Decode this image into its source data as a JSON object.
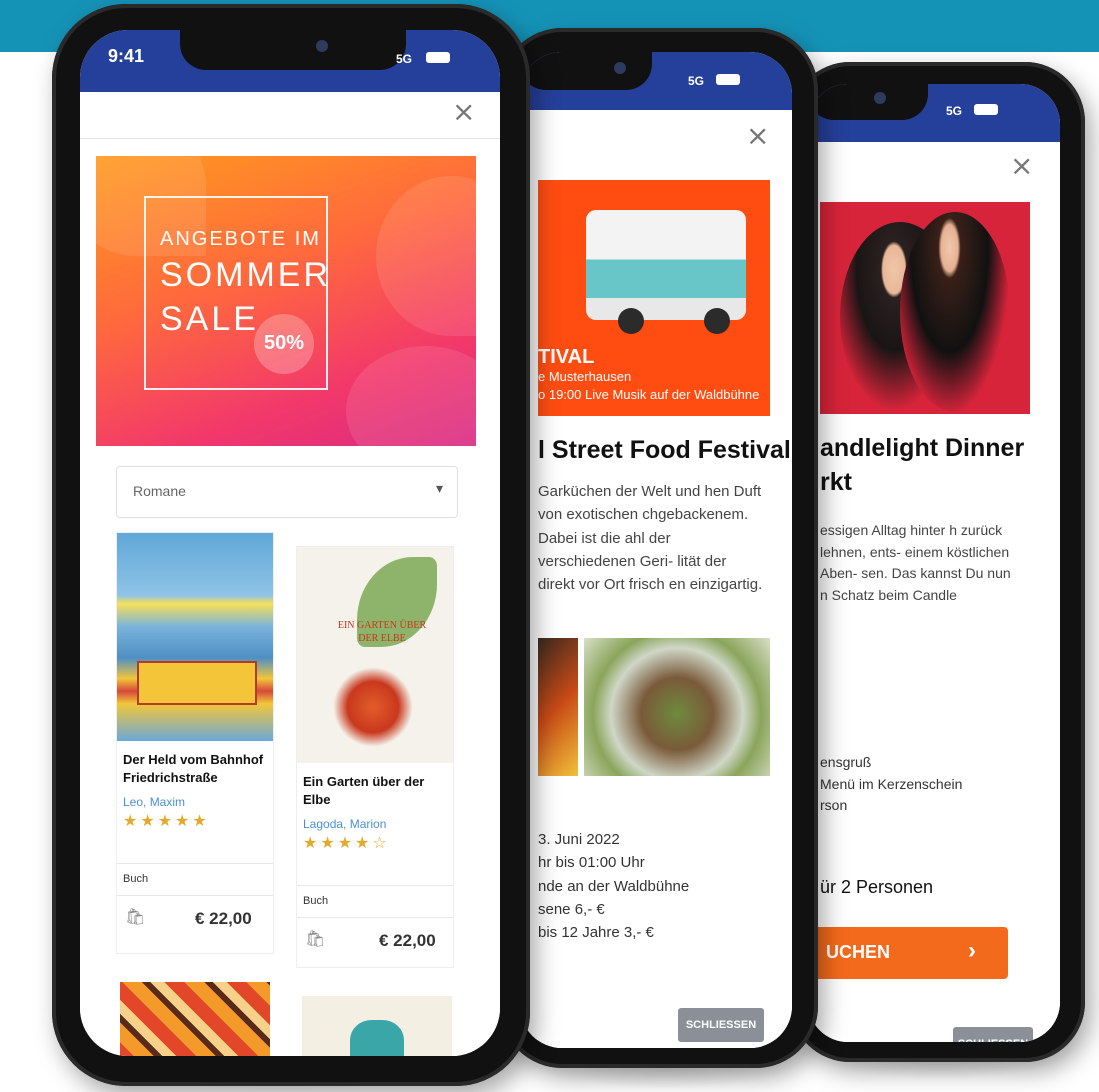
{
  "phone1": {
    "status": {
      "time": "9:41",
      "network": "5G"
    },
    "close": "×",
    "banner": {
      "line1": "ANGEBOTE IM",
      "line2": "SOMMER",
      "line3": "SALE",
      "badge_pct": "50%"
    },
    "filter": {
      "selected": "Romane",
      "arrow": "▾"
    },
    "books": [
      {
        "title": "Der Held vom Bahnhof Friedrichstraße",
        "author": "Leo, Maxim",
        "stars": "★★★★★",
        "rating": 5,
        "type": "Buch",
        "price": "€ 22,00"
      },
      {
        "title": "Ein Garten über der Elbe",
        "author": "Lagoda, Marion",
        "stars": "★★★★☆",
        "rating": 4,
        "type": "Buch",
        "price": "€ 22,00"
      }
    ],
    "cover_texts": {
      "garten": "EIN GARTEN ÜBER DER ELBE"
    }
  },
  "phone2": {
    "status": {
      "network": "5G"
    },
    "close": "×",
    "banner": {
      "line1": "TIVAL",
      "line2": "e Musterhausen",
      "line3": "o 19:00 Live Musik auf der Waldbühne"
    },
    "heading": "l Street Food Festival",
    "paragraph": "Garküchen der Welt und hen Duft von exotischen chgebackenem. Dabei ist die ahl der verschiedenen Geri- lität der direkt vor Ort frisch en einzigartig.",
    "info": [
      "3. Juni 2022",
      "hr bis 01:00 Uhr",
      "nde an der Waldbühne",
      "sene 6,- €",
      "bis 12 Jahre 3,- €"
    ],
    "close_button": "SCHLIESSEN"
  },
  "phone3": {
    "status": {
      "network": "5G"
    },
    "close": "×",
    "heading_line1": "andlelight Dinner",
    "heading_line2": "rkt",
    "paragraph": "essigen Alltag hinter h zurück lehnen, ents- einem köstlichen Aben- sen. Das kannst Du nun n Schatz beim Candle",
    "info": [
      "ensgruß",
      "Menü im Kerzenschein",
      "rson"
    ],
    "price_line": "ür 2 Personen",
    "book_button": "UCHEN",
    "book_arrow": "›",
    "close_button": "SCHLIESSEN"
  }
}
